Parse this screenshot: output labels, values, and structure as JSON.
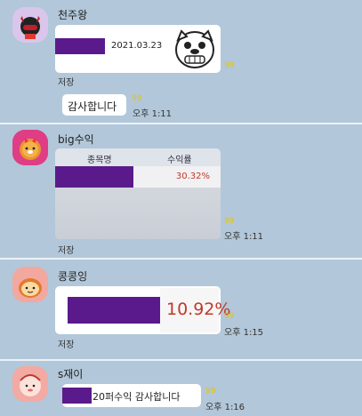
{
  "messages": [
    {
      "sender": "천주왕",
      "date_text": "2021.03.23",
      "save_label": "저장",
      "unread": "99",
      "reply_text": "감사합니다",
      "reply_unread": "99",
      "reply_time": "오후 1:11"
    },
    {
      "sender": "big수익",
      "table_header_name": "종목명",
      "table_header_return": "수익률",
      "return_value": "30.32%",
      "save_label": "저장",
      "unread": "99",
      "time": "오후 1:11"
    },
    {
      "sender": "콩콩잉",
      "return_value": "10.92%",
      "save_label": "저장",
      "unread": "99",
      "time": "오후 1:15"
    },
    {
      "sender": "s재이",
      "message_text": "20퍼수익 감사합니다",
      "unread": "99",
      "time": "오후 1:16"
    }
  ],
  "colors": {
    "chat_background": "#b2c7d9",
    "redaction": "#5b1a8b",
    "unread_count": "#e8c400",
    "return_red": "#c0392b"
  }
}
